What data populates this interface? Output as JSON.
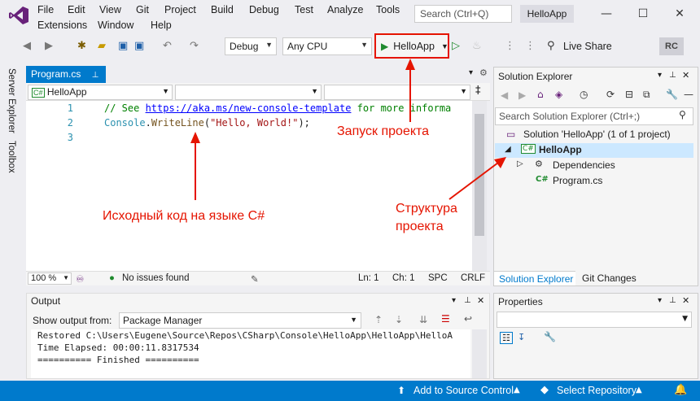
{
  "menu": {
    "items": [
      "File",
      "Edit",
      "View",
      "Git",
      "Project",
      "Build",
      "Debug",
      "Test",
      "Analyze",
      "Tools",
      "Extensions",
      "Window",
      "Help"
    ],
    "search_placeholder": "Search (Ctrl+Q)",
    "app_name": "HelloApp"
  },
  "toolbar": {
    "config": "Debug",
    "platform": "Any CPU",
    "run_label": "HelloApp",
    "live_share": "Live Share",
    "avatar": "RC"
  },
  "left_tabs": [
    "Server Explorer",
    "Toolbox"
  ],
  "editor": {
    "tab": "Program.cs",
    "project_combo": "HelloApp",
    "line_numbers": [
      "1",
      "2",
      "3"
    ],
    "line1_comment": "// See ",
    "line1_link": "https://aka.ms/new-console-template",
    "line1_rest": " for more informa",
    "line2_ident": "Console",
    "line2_dot": ".",
    "line2_method": "WriteLine",
    "line2_open": "(",
    "line2_str": "\"Hello, World!\"",
    "line2_close": ");",
    "zoom": "100 %",
    "issues": "No issues found",
    "ln": "Ln: 1",
    "ch": "Ch: 1",
    "spc": "SPC",
    "crlf": "CRLF"
  },
  "output": {
    "title": "Output",
    "show_from_label": "Show output from:",
    "source": "Package Manager",
    "lines": [
      "Restored C:\\Users\\Eugene\\Source\\Repos\\CSharp\\Console\\HelloApp\\HelloApp\\HelloA",
      "Time Elapsed: 00:00:11.8317534",
      "========== Finished =========="
    ]
  },
  "solution_explorer": {
    "title": "Solution Explorer",
    "search_placeholder": "Search Solution Explorer (Ctrl+;)",
    "solution": "Solution 'HelloApp' (1 of 1 project)",
    "project": "HelloApp",
    "dependencies": "Dependencies",
    "file": "Program.cs",
    "tab_solution": "Solution Explorer",
    "tab_git": "Git Changes"
  },
  "properties": {
    "title": "Properties"
  },
  "statusbar": {
    "source_control": "Add to Source Control",
    "repository": "Select Repository"
  },
  "annotations": {
    "run": "Запуск проекта",
    "source": "Исходный код на языке C#",
    "structure_1": "Структура",
    "structure_2": "проекта"
  },
  "colors": {
    "accent": "#007acc",
    "annotation": "#e51400",
    "run_green": "#1f8a2e"
  }
}
